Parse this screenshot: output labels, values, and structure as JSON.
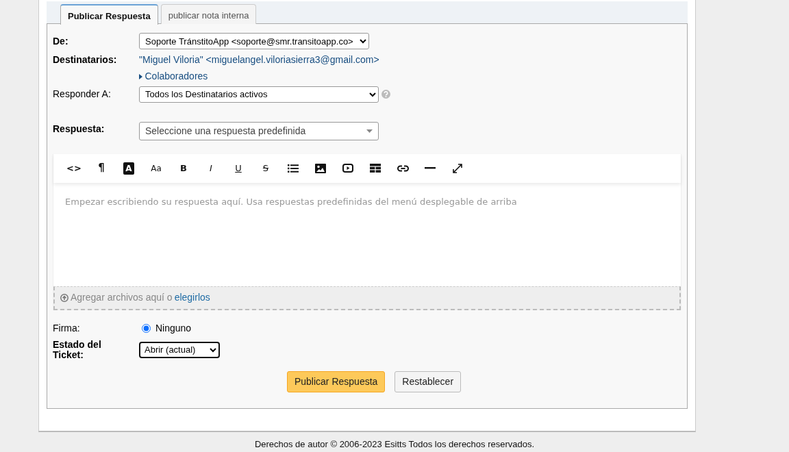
{
  "tabs": [
    {
      "label": "Publicar Respuesta",
      "selected": true
    },
    {
      "label": "publicar nota interna",
      "selected": false
    }
  ],
  "from": {
    "label": "De:",
    "value": "Soporte TránstitoApp <soporte@smr.transitoapp.co>"
  },
  "recipients": {
    "label": "Destinatarios:",
    "value": "\"Miguel Viloria\" <miguelangel.viloriasierra3@gmail.com>",
    "collaborators": {
      "label": "Colaboradores",
      "expanded": false
    }
  },
  "reply_to": {
    "label": "Responder A:",
    "value": "Todos los Destinatarios activos"
  },
  "response": {
    "label": "Respuesta:",
    "placeholder": "Seleccione una respuesta predefinida"
  },
  "editor": {
    "toolbar": [
      {
        "kind": "html",
        "label": "<>"
      },
      {
        "kind": "format",
        "label": "¶"
      },
      {
        "kind": "fontcolor",
        "label": "A"
      },
      {
        "kind": "fontsize",
        "label": "Aa"
      },
      {
        "kind": "bold",
        "label": "B"
      },
      {
        "kind": "italic",
        "label": "I"
      },
      {
        "kind": "underline",
        "label": "U"
      },
      {
        "kind": "deleted",
        "label": "S"
      },
      {
        "kind": "lists"
      },
      {
        "kind": "image"
      },
      {
        "kind": "video"
      },
      {
        "kind": "table"
      },
      {
        "kind": "link"
      },
      {
        "kind": "line"
      },
      {
        "kind": "fullscreen"
      }
    ],
    "placeholder": "Empezar escribiendo su respuesta aquí. Usa respuestas predefinidas del menú desplegable de arriba",
    "attach_text": "Agregar archivos aquí o",
    "attach_link": "elegirlos"
  },
  "signature": {
    "label": "Firma:",
    "options": [
      {
        "label": "Ninguno",
        "selected": true
      }
    ]
  },
  "status": {
    "label": "Estado del Ticket:",
    "value": "Abrir (actual)"
  },
  "buttons": [
    {
      "label": "Publicar Respuesta",
      "kind": "primary"
    },
    {
      "label": "Restablecer",
      "kind": "secondary"
    }
  ],
  "footer": "Derechos de autor © 2006-2023 Esitts Todos los derechos reservados."
}
